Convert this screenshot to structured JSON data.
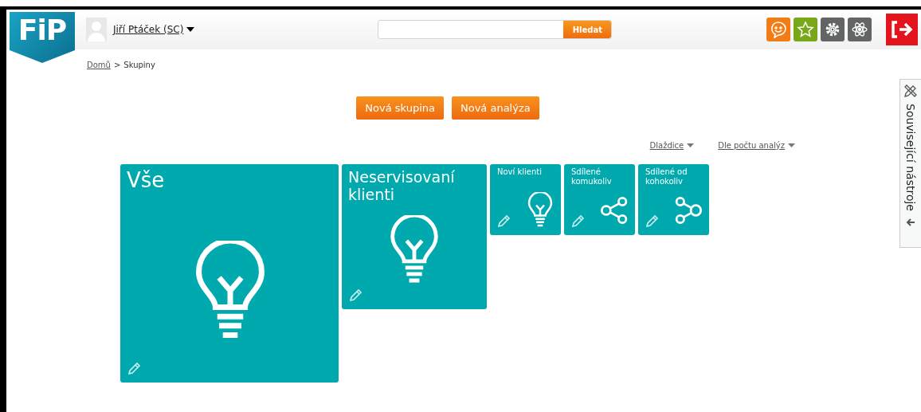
{
  "header": {
    "user": "Jiří Ptáček (SC)",
    "search": {
      "button": "Hledat"
    },
    "logo": "FiP"
  },
  "breadcrumb": [
    {
      "label": "Domů",
      "link": true
    },
    {
      "label": ">",
      "link": false
    },
    {
      "label": "Skupiny",
      "link": false
    }
  ],
  "actions": [
    "Nová skupina",
    "Nová analýza"
  ],
  "sort": [
    "Dlaždice",
    "Dle počtu analýz"
  ],
  "tiles": [
    {
      "title": "Vše",
      "kind": "large-bulb"
    },
    {
      "title": "Neservisovaní klienti",
      "kind": "medium-bulb"
    },
    {
      "title": "Noví klienti",
      "kind": "small-bulb"
    },
    {
      "title": "Sdílené komukoliv",
      "kind": "small-shareout"
    },
    {
      "title": "Sdílené od kohokoliv",
      "kind": "small-sharein"
    }
  ],
  "side_panel": {
    "label": "Související nástroje"
  }
}
